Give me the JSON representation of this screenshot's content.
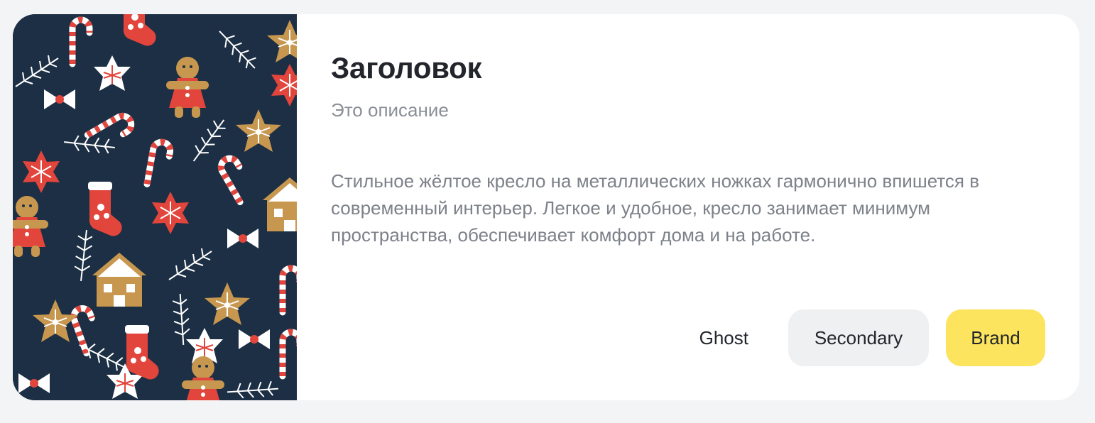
{
  "card": {
    "title": "Заголовок",
    "subtitle": "Это описание",
    "description": "Стильное жёлтое кресло на металлических ножках гармонично впишется в современный интерьер. Легкое и удобное, кресло занимает минимум пространства, обеспечивает комфорт дома и на работе.",
    "image_icon": "christmas-pattern-illustration"
  },
  "actions": {
    "ghost_label": "Ghost",
    "secondary_label": "Secondary",
    "brand_label": "Brand"
  },
  "colors": {
    "background": "#f3f4f6",
    "card": "#ffffff",
    "brand": "#fce45e",
    "secondary": "#eff0f2",
    "pattern_bg": "#1c2f44",
    "pattern_red": "#e2453c",
    "pattern_gold": "#c7974f"
  }
}
